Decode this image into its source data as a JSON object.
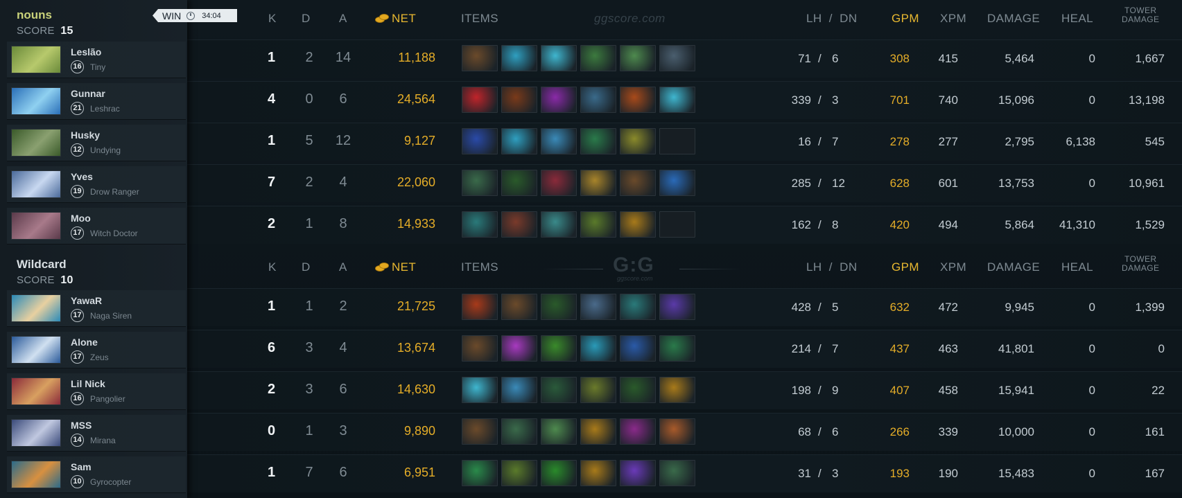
{
  "watermark_text": "ggscore.com",
  "logo_text": "G:G",
  "logo_sub": "ggscore.com",
  "match": {
    "result": "WIN",
    "duration": "34:04"
  },
  "headers": {
    "k": "K",
    "d": "D",
    "a": "A",
    "net": "NET",
    "items": "ITEMS",
    "lh": "LH",
    "slash": "/",
    "dn": "DN",
    "gpm": "GPM",
    "xpm": "XPM",
    "damage": "DAMAGE",
    "heal": "HEAL",
    "tower_line1": "TOWER",
    "tower_line2": "DAMAGE"
  },
  "teams": [
    {
      "name": "nouns",
      "score_label": "SCORE",
      "score": "15",
      "players": [
        {
          "name": "Leslão",
          "level": "16",
          "hero": "Tiny",
          "k": "1",
          "d": "2",
          "a": "14",
          "net": "11,188",
          "lh": "71",
          "dn": "6",
          "gpm": "308",
          "xpm": "415",
          "damage": "5,464",
          "heal": "0",
          "tower": "1,667",
          "portrait": [
            "#6a8a3a",
            "#b7c96c"
          ],
          "items": [
            "#6b4a2a",
            "#2f9fc0",
            "#3fb6cf",
            "#3c7a3e",
            "#4e8a4e",
            "#4a5e6e"
          ]
        },
        {
          "name": "Gunnar",
          "level": "21",
          "hero": "Leshrac",
          "k": "4",
          "d": "0",
          "a": "6",
          "net": "24,564",
          "lh": "339",
          "dn": "3",
          "gpm": "701",
          "xpm": "740",
          "damage": "15,096",
          "heal": "0",
          "tower": "13,198",
          "portrait": [
            "#2a6fb8",
            "#8fd0f0"
          ],
          "items": [
            "#c0242a",
            "#7a3a1a",
            "#8a2aa8",
            "#3a6a8a",
            "#a84a1a",
            "#3fb6cf"
          ]
        },
        {
          "name": "Husky",
          "level": "12",
          "hero": "Undying",
          "k": "1",
          "d": "5",
          "a": "12",
          "net": "9,127",
          "lh": "16",
          "dn": "7",
          "gpm": "278",
          "xpm": "277",
          "damage": "2,795",
          "heal": "6,138",
          "tower": "545",
          "portrait": [
            "#3a5a2a",
            "#8aa070"
          ],
          "items": [
            "#2a4aa8",
            "#2f9fc0",
            "#3a8ab8",
            "#2a7a4a",
            "#8a8a2a",
            ""
          ]
        },
        {
          "name": "Yves",
          "level": "19",
          "hero": "Drow Ranger",
          "k": "7",
          "d": "2",
          "a": "4",
          "net": "22,060",
          "lh": "285",
          "dn": "12",
          "gpm": "628",
          "xpm": "601",
          "damage": "13,753",
          "heal": "0",
          "tower": "10,961",
          "portrait": [
            "#4a6a9a",
            "#c8d8f0"
          ],
          "items": [
            "#3a6a4a",
            "#2a5a2a",
            "#8a2a3a",
            "#a8842a",
            "#6a4a2a",
            "#2a6ab8"
          ]
        },
        {
          "name": "Moo",
          "level": "17",
          "hero": "Witch Doctor",
          "k": "2",
          "d": "1",
          "a": "8",
          "net": "14,933",
          "lh": "162",
          "dn": "8",
          "gpm": "420",
          "xpm": "494",
          "damage": "5,864",
          "heal": "41,310",
          "tower": "1,529",
          "portrait": [
            "#5a3a4a",
            "#a87a8a"
          ],
          "items": [
            "#2a7a7a",
            "#7a3a2a",
            "#3a8a8a",
            "#5a7a2a",
            "#a87a1a",
            ""
          ]
        }
      ]
    },
    {
      "name": "Wildcard",
      "score_label": "SCORE",
      "score": "10",
      "players": [
        {
          "name": "YawaR",
          "level": "17",
          "hero": "Naga Siren",
          "k": "1",
          "d": "1",
          "a": "2",
          "net": "21,725",
          "lh": "428",
          "dn": "5",
          "gpm": "632",
          "xpm": "472",
          "damage": "9,945",
          "heal": "0",
          "tower": "1,399",
          "portrait": [
            "#2a8ab8",
            "#e8d0a0"
          ],
          "items": [
            "#a83a1a",
            "#6b4a2a",
            "#2a5a2a",
            "#4a6a8a",
            "#2a7a7a",
            "#5a3aa8"
          ]
        },
        {
          "name": "Alone",
          "level": "17",
          "hero": "Zeus",
          "k": "6",
          "d": "3",
          "a": "4",
          "net": "13,674",
          "lh": "214",
          "dn": "7",
          "gpm": "437",
          "xpm": "463",
          "damage": "41,801",
          "heal": "0",
          "tower": "0",
          "portrait": [
            "#2a5a9a",
            "#d0e0f0"
          ],
          "items": [
            "#6b4a2a",
            "#a83ac0",
            "#3a8a2a",
            "#2a9ab8",
            "#2a5aa8",
            "#2a7a4a"
          ]
        },
        {
          "name": "Lil Nick",
          "level": "16",
          "hero": "Pangolier",
          "k": "2",
          "d": "3",
          "a": "6",
          "net": "14,630",
          "lh": "198",
          "dn": "9",
          "gpm": "407",
          "xpm": "458",
          "damage": "15,941",
          "heal": "0",
          "tower": "22",
          "portrait": [
            "#8a2a3a",
            "#d8a060"
          ],
          "items": [
            "#3fb6cf",
            "#3a8ab8",
            "#2a5a3a",
            "#6a7a2a",
            "#2a5a2a",
            "#a87a1a"
          ]
        },
        {
          "name": "MSS",
          "level": "14",
          "hero": "Mirana",
          "k": "0",
          "d": "1",
          "a": "3",
          "net": "9,890",
          "lh": "68",
          "dn": "6",
          "gpm": "266",
          "xpm": "339",
          "damage": "10,000",
          "heal": "0",
          "tower": "161",
          "portrait": [
            "#3a4a7a",
            "#c0c8e0"
          ],
          "items": [
            "#6b4a2a",
            "#3a6a4a",
            "#4e8a4e",
            "#a87a1a",
            "#8a2a8a",
            "#a85a2a"
          ]
        },
        {
          "name": "Sam",
          "level": "10",
          "hero": "Gyrocopter",
          "k": "1",
          "d": "7",
          "a": "6",
          "net": "6,951",
          "lh": "31",
          "dn": "3",
          "gpm": "193",
          "xpm": "190",
          "damage": "15,483",
          "heal": "0",
          "tower": "167",
          "portrait": [
            "#2a6a8a",
            "#d89040"
          ],
          "items": [
            "#2a8a4a",
            "#5a7a2a",
            "#2a8a2a",
            "#a87a1a",
            "#6a3ab8",
            "#3a6a4a"
          ]
        }
      ]
    }
  ]
}
